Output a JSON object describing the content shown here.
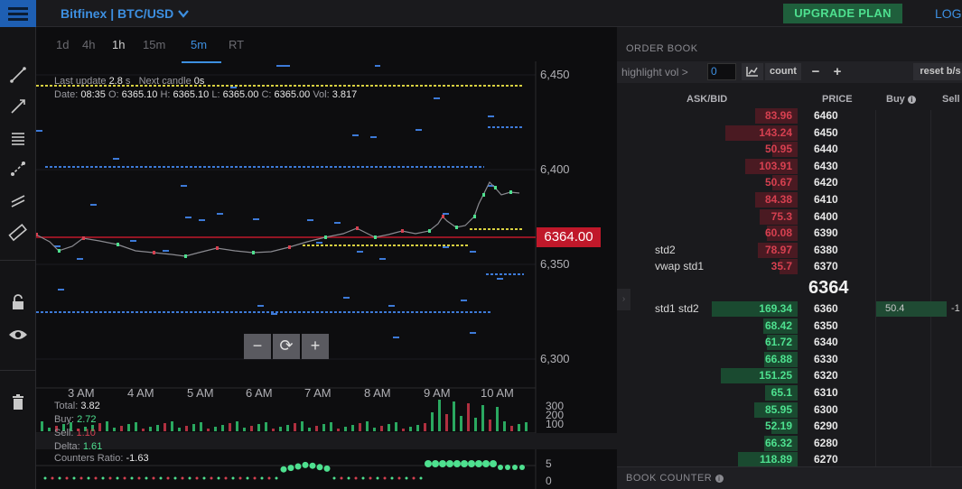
{
  "header": {
    "market": "Bitfinex | BTC/USD",
    "upgrade_label": "UPGRADE PLAN",
    "login_label": "LOGI"
  },
  "timeframes": [
    {
      "label": "1d",
      "state": "normal"
    },
    {
      "label": "4h",
      "state": "normal"
    },
    {
      "label": "1h",
      "state": "bold"
    },
    {
      "label": "15m",
      "state": "normal"
    },
    {
      "label": "5m",
      "state": "active"
    },
    {
      "label": "RT",
      "state": "normal"
    }
  ],
  "chart_info": {
    "last_update_label": "Last update",
    "last_update_value": "2.8",
    "last_update_unit": "s",
    "next_candle_label": "Next candle",
    "next_candle_value": "0s",
    "date_label": "Date:",
    "date_value": "08:35",
    "o_label": "O:",
    "o_value": "6365.10",
    "h_label": "H:",
    "h_value": "6365.10",
    "l_label": "L:",
    "l_value": "6365.00",
    "c_label": "C:",
    "c_value": "6365.00",
    "vol_label": "Vol:",
    "vol_value": "3.817"
  },
  "price_axis": [
    "6,450",
    "6,400",
    "6,350",
    "6,300"
  ],
  "time_axis": [
    "3 AM",
    "4 AM",
    "5 AM",
    "6 AM",
    "7 AM",
    "8 AM",
    "9 AM",
    "10 AM"
  ],
  "current_price_tag": "6364.00",
  "zoom": {
    "minus": "−",
    "reset": "⟳",
    "plus": "+"
  },
  "volume_panel": {
    "total_label": "Total:",
    "total_value": "3.82",
    "buy_label": "Buy:",
    "buy_value": "2.72",
    "sell_label": "Sell:",
    "sell_value": "1.10",
    "axis": [
      "300",
      "200",
      "100"
    ]
  },
  "delta_panel": {
    "delta_label": "Delta:",
    "delta_value": "1.61",
    "ratio_label": "Counters Ratio:",
    "ratio_value": "-1.63",
    "axis": [
      "5",
      "0"
    ]
  },
  "order_book": {
    "title": "ORDER BOOK",
    "highlight_label": "highlight vol >",
    "highlight_value": "0",
    "count_label": "count",
    "reset_label": "reset b/s",
    "headers": {
      "askbid": "ASK/BID",
      "price": "PRICE",
      "buy": "Buy",
      "sell": "Sell"
    },
    "asks": [
      {
        "amount": "83.96",
        "price": "6460",
        "tag": ""
      },
      {
        "amount": "143.24",
        "price": "6450",
        "tag": ""
      },
      {
        "amount": "50.95",
        "price": "6440",
        "tag": ""
      },
      {
        "amount": "103.91",
        "price": "6430",
        "tag": ""
      },
      {
        "amount": "50.67",
        "price": "6420",
        "tag": ""
      },
      {
        "amount": "84.38",
        "price": "6410",
        "tag": ""
      },
      {
        "amount": "75.3",
        "price": "6400",
        "tag": ""
      },
      {
        "amount": "60.08",
        "price": "6390",
        "tag": ""
      },
      {
        "amount": "78.97",
        "price": "6380",
        "tag": "std2"
      },
      {
        "amount": "35.7",
        "price": "6370",
        "tag": "vwap std1"
      }
    ],
    "last_price": "6364",
    "bids": [
      {
        "amount": "169.34",
        "price": "6360",
        "tag": "std1 std2"
      },
      {
        "amount": "68.42",
        "price": "6350",
        "tag": ""
      },
      {
        "amount": "61.72",
        "price": "6340",
        "tag": ""
      },
      {
        "amount": "66.88",
        "price": "6330",
        "tag": ""
      },
      {
        "amount": "151.25",
        "price": "6320",
        "tag": ""
      },
      {
        "amount": "65.1",
        "price": "6310",
        "tag": ""
      },
      {
        "amount": "85.95",
        "price": "6300",
        "tag": ""
      },
      {
        "amount": "52.19",
        "price": "6290",
        "tag": ""
      },
      {
        "amount": "66.32",
        "price": "6280",
        "tag": ""
      },
      {
        "amount": "118.89",
        "price": "6270",
        "tag": ""
      }
    ],
    "buy_value": "50.4",
    "sell_value": "-1"
  },
  "book_counter": {
    "title": "BOOK COUNTER"
  },
  "colors": {
    "accent": "#3d8fe0",
    "ask": "#d64050",
    "bid": "#4ee08f",
    "price_tag": "#c0182a"
  }
}
